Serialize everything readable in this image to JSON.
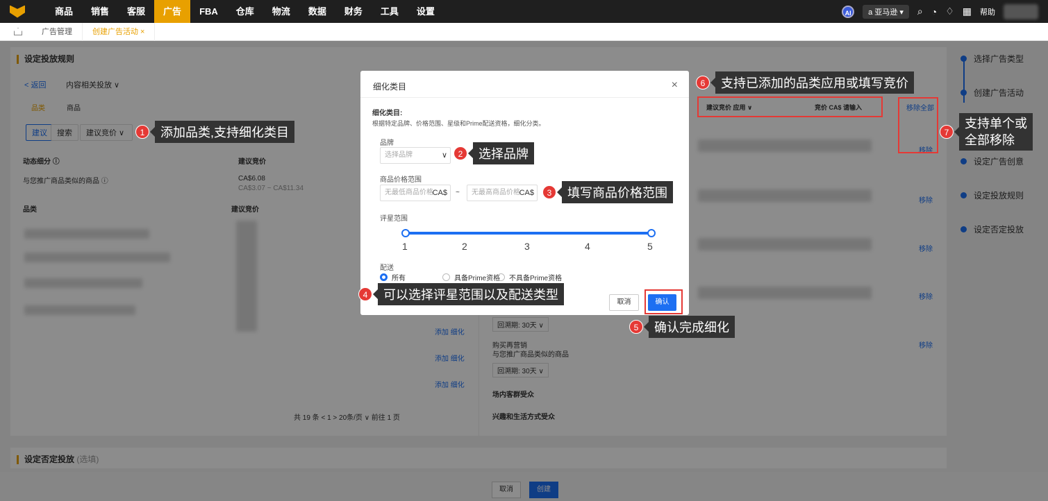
{
  "topnav": {
    "items": [
      "商品",
      "销售",
      "客服",
      "广告",
      "FBA",
      "仓库",
      "物流",
      "数据",
      "财务",
      "工具",
      "设置"
    ],
    "ai_label": "AI",
    "store_label": "a 亚马逊 ▾",
    "help_label": "帮助"
  },
  "tabs": {
    "items": [
      "广告管理",
      "创建广告活动 ×"
    ]
  },
  "page": {
    "section1_title": "设定投放规则",
    "back": "< 返回",
    "targeting_type": "内容相关投放 ∨",
    "sub_tab1": "品类",
    "sub_tab2": "商品",
    "btn_suggest": "建议",
    "btn_search": "搜索",
    "bid_select": "建议竞价  ∨",
    "col_dynamic": "动态细分 ⓘ",
    "col_suggest_bid": "建议竞价",
    "row_similar": "与您推广商品类似的商品 ⓘ",
    "bid_value": "CA$6.08",
    "bid_range": "CA$3.07 ~ CA$11.34",
    "col_category": "品类",
    "col_suggest_bid2": "建议竞价",
    "add_refine1": "添加  细化",
    "add_refine2": "添加  细化",
    "add_refine3": "添加  细化",
    "pagination": "共 19 条   <   1   >    20条/页 ∨    前往   1   页",
    "right_header_bid": "建议竞价 应用 ∨",
    "right_header_bid2": "竞价 CA$  请输入",
    "remove_all": "移除全部",
    "remove": "移除",
    "lookback1": "回溯期: 30天 ∨",
    "remarketing": "购买再营销",
    "remarketing_sub": "与您推广商品类似的商品",
    "lookback2": "回溯期: 30天 ∨",
    "inmarket": "场内客群受众",
    "lifestyle": "兴趣和生活方式受众",
    "section2_title": "设定否定投放",
    "section2_optional": "(选填)",
    "bottom_cancel": "取消",
    "bottom_create": "创建"
  },
  "steps": [
    "选择广告类型",
    "创建广告活动",
    "设定广告创意",
    "设定投放规则",
    "设定否定投放"
  ],
  "dialog": {
    "title": "细化类目",
    "close": "×",
    "heading": "细化类目:",
    "desc": "根据特定品牌、价格范围、星级和Prime配送资格，细化分类。",
    "brand_label": "品牌",
    "brand_placeholder": "选择品牌",
    "price_label": "商品价格范围",
    "price_min_placeholder": "无最低商品价格",
    "price_max_placeholder": "无最高商品价格",
    "currency": "CA$",
    "tilde": "~",
    "rating_label": "评星范围",
    "ticks": [
      "1",
      "2",
      "3",
      "4",
      "5"
    ],
    "rating_range": [
      1,
      5
    ],
    "delivery_label": "配送",
    "radio_all": "所有",
    "radio_prime": "具备Prime资格",
    "radio_noprime": "不具备Prime资格",
    "cancel": "取消",
    "confirm": "确认"
  },
  "annotations": [
    {
      "n": "1",
      "text": "添加品类,支持细化类目"
    },
    {
      "n": "2",
      "text": "选择品牌"
    },
    {
      "n": "3",
      "text": "填写商品价格范围"
    },
    {
      "n": "4",
      "text": "可以选择评星范围以及配送类型"
    },
    {
      "n": "5",
      "text": "确认完成细化"
    },
    {
      "n": "6",
      "text": "支持已添加的品类应用或填写竞价"
    },
    {
      "n": "7",
      "text": "支持单个或\n全部移除"
    }
  ],
  "colors": {
    "accent": "#e8a000",
    "primary": "#1d6ff2",
    "annotation": "#e53935"
  }
}
